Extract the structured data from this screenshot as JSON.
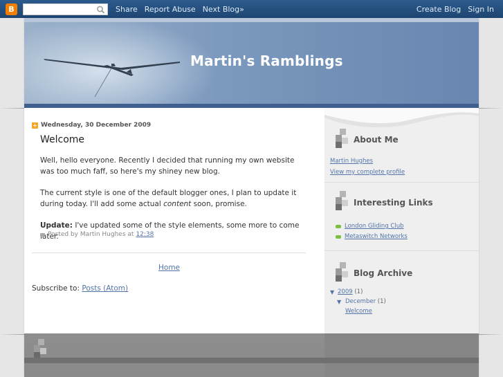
{
  "navbar": {
    "logo_letter": "B",
    "search_placeholder": "",
    "links": [
      "Share",
      "Report Abuse",
      "Next Blog»"
    ],
    "right_links": [
      "Create Blog",
      "Sign In"
    ]
  },
  "header": {
    "title": "Martin's Ramblings"
  },
  "post": {
    "date": "Wednesday, 30 December 2009",
    "title": "Welcome",
    "p1": "Well, hello everyone. Recently I decided that running my own website was too much faff, so here's my shiney new blog.",
    "p2_before": "The current style is one of the default blogger ones, I plan to update it during today. I'll add some actual ",
    "p2_em": "content",
    "p2_after": " soon, promise.",
    "p3_strong": "Update:",
    "p3_rest": " I've updated some of the style elements, some more to come later.",
    "footer_prefix": "Posted by Martin Hughes at",
    "footer_time": "12:38"
  },
  "main": {
    "home_link": "Home",
    "subscribe_label": "Subscribe to:",
    "subscribe_link": "Posts (Atom)"
  },
  "sidebar": {
    "about": {
      "heading": "About Me",
      "name_link": "Martin Hughes",
      "profile_link": "View my complete profile"
    },
    "links": {
      "heading": "Interesting Links",
      "items": [
        "London Gliding Club",
        "Metaswitch Networks"
      ]
    },
    "archive": {
      "heading": "Blog Archive",
      "year": "2009",
      "year_count": "(1)",
      "month": "December",
      "month_count": "(1)",
      "post": "Welcome"
    }
  },
  "colors": {
    "accent_link": "#5273a8",
    "navbar": "#1d4572",
    "header_bar": "#3f5f8e"
  }
}
